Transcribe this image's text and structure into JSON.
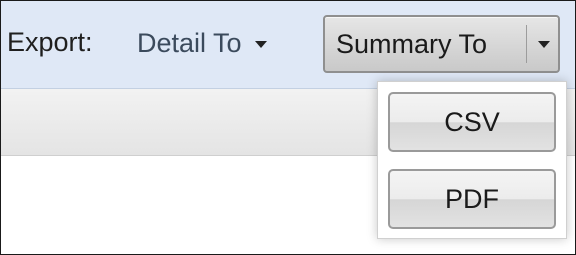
{
  "toolbar": {
    "export_label": "Export:",
    "detail_button_label": "Detail To",
    "summary_button_label": "Summary To"
  },
  "export_menu": {
    "items": [
      {
        "label": "CSV"
      },
      {
        "label": "PDF"
      }
    ]
  }
}
